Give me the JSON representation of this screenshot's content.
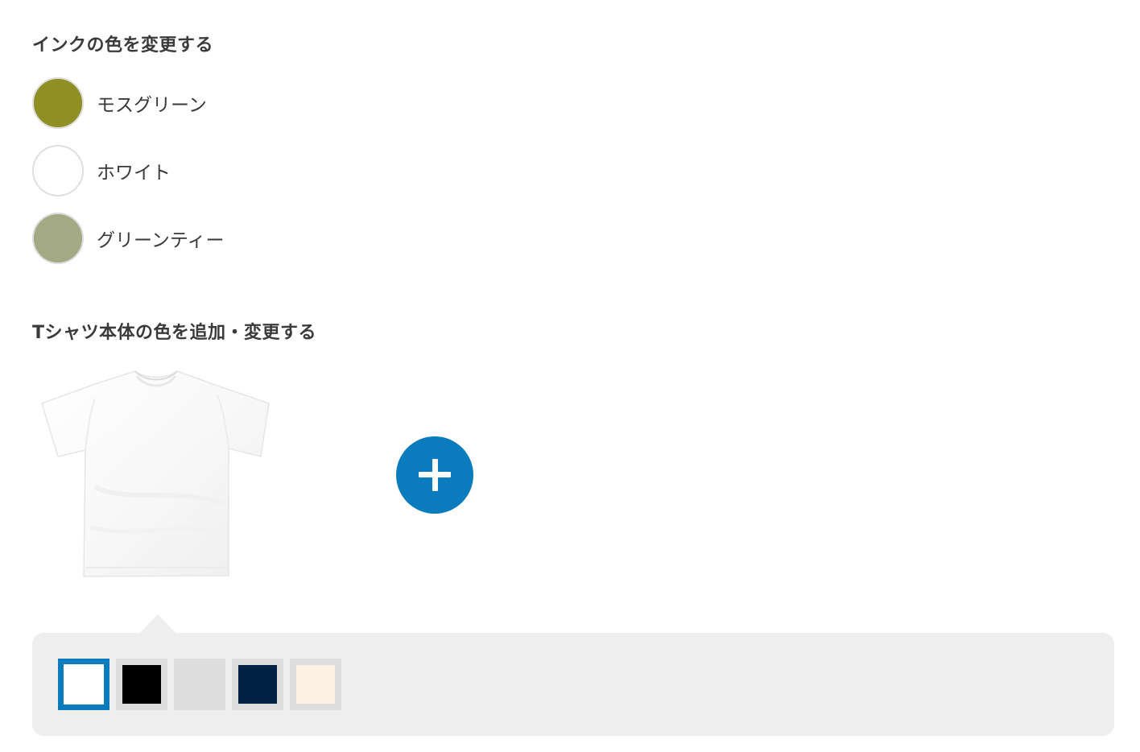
{
  "ink_section": {
    "title": "インクの色を変更する",
    "options": [
      {
        "label": "モスグリーン",
        "color": "#8f8f24"
      },
      {
        "label": "ホワイト",
        "color": "#ffffff"
      },
      {
        "label": "グリーンティー",
        "color": "#a4ab84"
      }
    ]
  },
  "body_section": {
    "title": "Tシャツ本体の色を追加・変更する",
    "current_shirt_color": "#ffffff",
    "add_button_icon": "plus-icon",
    "accent_color": "#0a7cbd",
    "swatches": [
      {
        "color": "#ffffff",
        "selected": true
      },
      {
        "color": "#000000",
        "selected": false
      },
      {
        "color": "#dddddd",
        "selected": false
      },
      {
        "color": "#002245",
        "selected": false
      },
      {
        "color": "#fdf2e4",
        "selected": false
      }
    ]
  }
}
